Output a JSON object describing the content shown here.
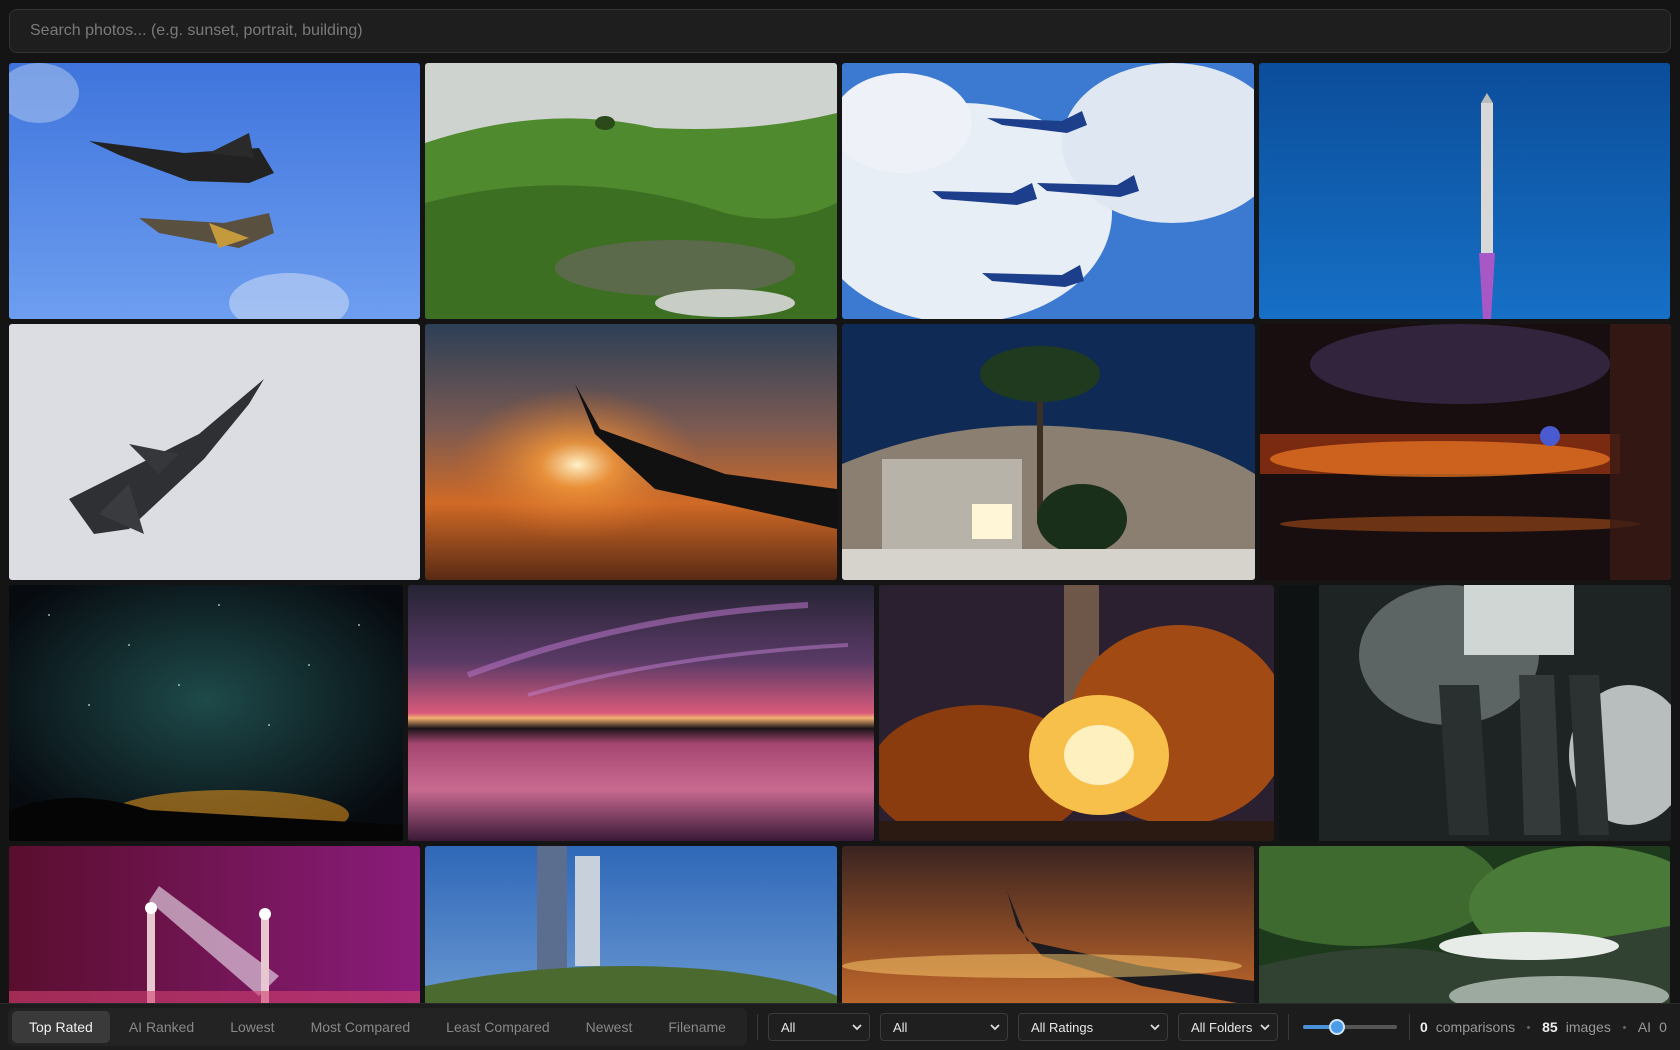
{
  "search": {
    "placeholder": "Search photos... (e.g. sunset, portrait, building)"
  },
  "photos": [
    {
      "name": "photo-jets-formation-blue-sky",
      "label": "F-16 and P-51 flying together"
    },
    {
      "name": "photo-green-hills-pond",
      "label": "Green rolling hills with pond"
    },
    {
      "name": "photo-thunderbirds-formation",
      "label": "Thunderbirds jets in formation"
    },
    {
      "name": "photo-rocket-launch-blue-sky",
      "label": "Rocket launching into blue sky"
    },
    {
      "name": "photo-fighter-jet-grey-sky",
      "label": "Fighter jet against grey sky"
    },
    {
      "name": "photo-airplane-wing-sunset",
      "label": "Airplane wing at sunset"
    },
    {
      "name": "photo-palm-tree-building-night",
      "label": "Palm tree over building at night"
    },
    {
      "name": "photo-city-lights-window",
      "label": "City lights through window"
    },
    {
      "name": "photo-milky-way-night-sky",
      "label": "Milky way night sky"
    },
    {
      "name": "photo-purple-sunset-lake",
      "label": "Purple sunset over lake"
    },
    {
      "name": "photo-rocket-launch-fire",
      "label": "Rocket launch fire and smoke"
    },
    {
      "name": "photo-launch-tower-steam",
      "label": "Launch tower with steam"
    },
    {
      "name": "photo-launch-pad-night-lights",
      "label": "Launch pad lights at night"
    },
    {
      "name": "photo-launch-tower-hill",
      "label": "Launch tower on hill"
    },
    {
      "name": "photo-wing-over-city-night",
      "label": "Wing over city at night"
    },
    {
      "name": "photo-forest-waterfall",
      "label": "Forest waterfall"
    }
  ],
  "toolbar": {
    "sort_options": [
      "Top Rated",
      "AI Ranked",
      "Lowest",
      "Most Compared",
      "Least Compared",
      "Newest",
      "Filename"
    ],
    "active_sort": "Top Rated",
    "filter1": "All",
    "filter2": "All",
    "ratings": "All Ratings",
    "folders": "All Folders",
    "slider_value": 0.36,
    "comparisons_count": "0",
    "comparisons_label": "comparisons",
    "images_count": "85",
    "images_label": "images",
    "ai_label": "AI",
    "ai_count": "0"
  },
  "colors": {
    "accent": "#4a90d9",
    "background": "#141414"
  }
}
